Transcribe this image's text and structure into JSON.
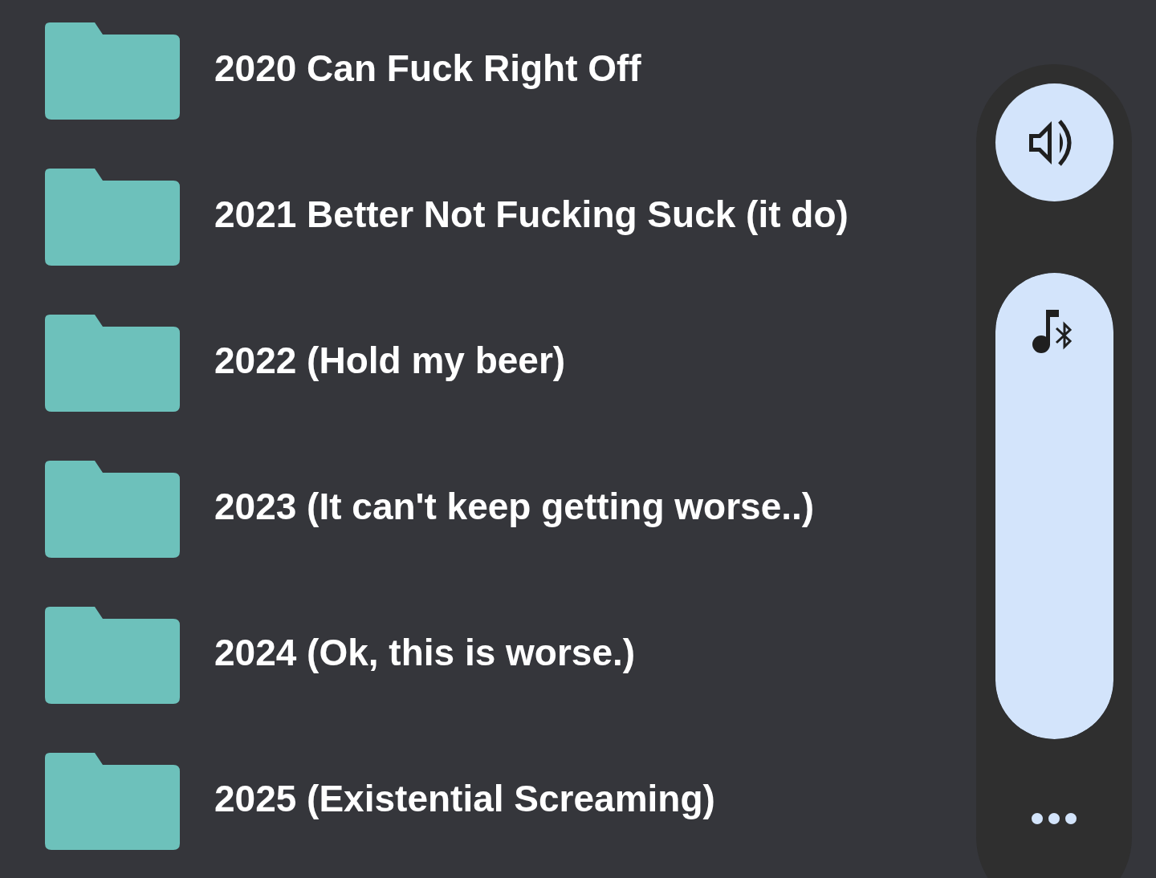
{
  "folders": [
    {
      "name": "2020 Can Fuck Right Off"
    },
    {
      "name": "2021 Better Not Fucking Suck (it do)"
    },
    {
      "name": "2022 (Hold my beer)"
    },
    {
      "name": "2023 (It can't keep getting worse..)"
    },
    {
      "name": "2024 (Ok, this is worse.)"
    },
    {
      "name": "2025 (Existential Screaming)"
    }
  ],
  "volume_panel": {
    "media_slider": {
      "level": 1
    }
  }
}
